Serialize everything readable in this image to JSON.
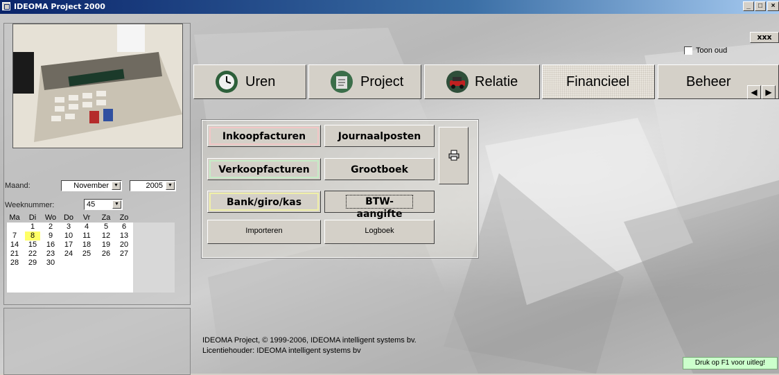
{
  "window": {
    "title": "IDEOMA Project 2000",
    "controls": [
      "_",
      "□",
      "×"
    ]
  },
  "close_form_label": "xxx",
  "toon_oud": {
    "label": "Toon oud",
    "checked": false
  },
  "tabs": [
    {
      "label": "Uren",
      "icon": "clock-icon",
      "active": false
    },
    {
      "label": "Project",
      "icon": "project-icon",
      "active": false
    },
    {
      "label": "Relatie",
      "icon": "car-icon",
      "active": false
    },
    {
      "label": "Financieel",
      "icon": "",
      "active": true
    },
    {
      "label": "Beheer",
      "icon": "",
      "active": false
    }
  ],
  "tab_scroll": {
    "left": "◀",
    "right": "▶"
  },
  "financial_buttons": {
    "inkoop": "Inkoopfacturen",
    "journaal": "Journaalposten",
    "verkoop": "Verkoopfacturen",
    "grootboek": "Grootboek",
    "bank": "Bank/giro/kas",
    "btw": "BTW-aangifte",
    "importeren": "Importeren",
    "logboek": "Logboek",
    "print_icon": "printer-icon"
  },
  "calendar": {
    "maand_label": "Maand:",
    "maand_value": "November",
    "jaar_value": "2005",
    "week_label": "Weeknummer:",
    "week_value": "45",
    "days": [
      "Ma",
      "Di",
      "Wo",
      "Do",
      "Vr",
      "Za",
      "Zo"
    ],
    "weeks": [
      [
        "",
        "1",
        "2",
        "3",
        "4",
        "5",
        "6"
      ],
      [
        "7",
        "8",
        "9",
        "10",
        "11",
        "12",
        "13"
      ],
      [
        "14",
        "15",
        "16",
        "17",
        "18",
        "19",
        "20"
      ],
      [
        "21",
        "22",
        "23",
        "24",
        "25",
        "26",
        "27"
      ],
      [
        "28",
        "29",
        "30",
        "",
        "",
        "",
        ""
      ]
    ],
    "today": "8"
  },
  "footer": {
    "line1": "IDEOMA Project, © 1999-2006, IDEOMA intelligent systems bv.",
    "line2": "Licentiehouder: IDEOMA intelligent systems bv"
  },
  "status_hint": "Druk op F1 voor uitleg!"
}
